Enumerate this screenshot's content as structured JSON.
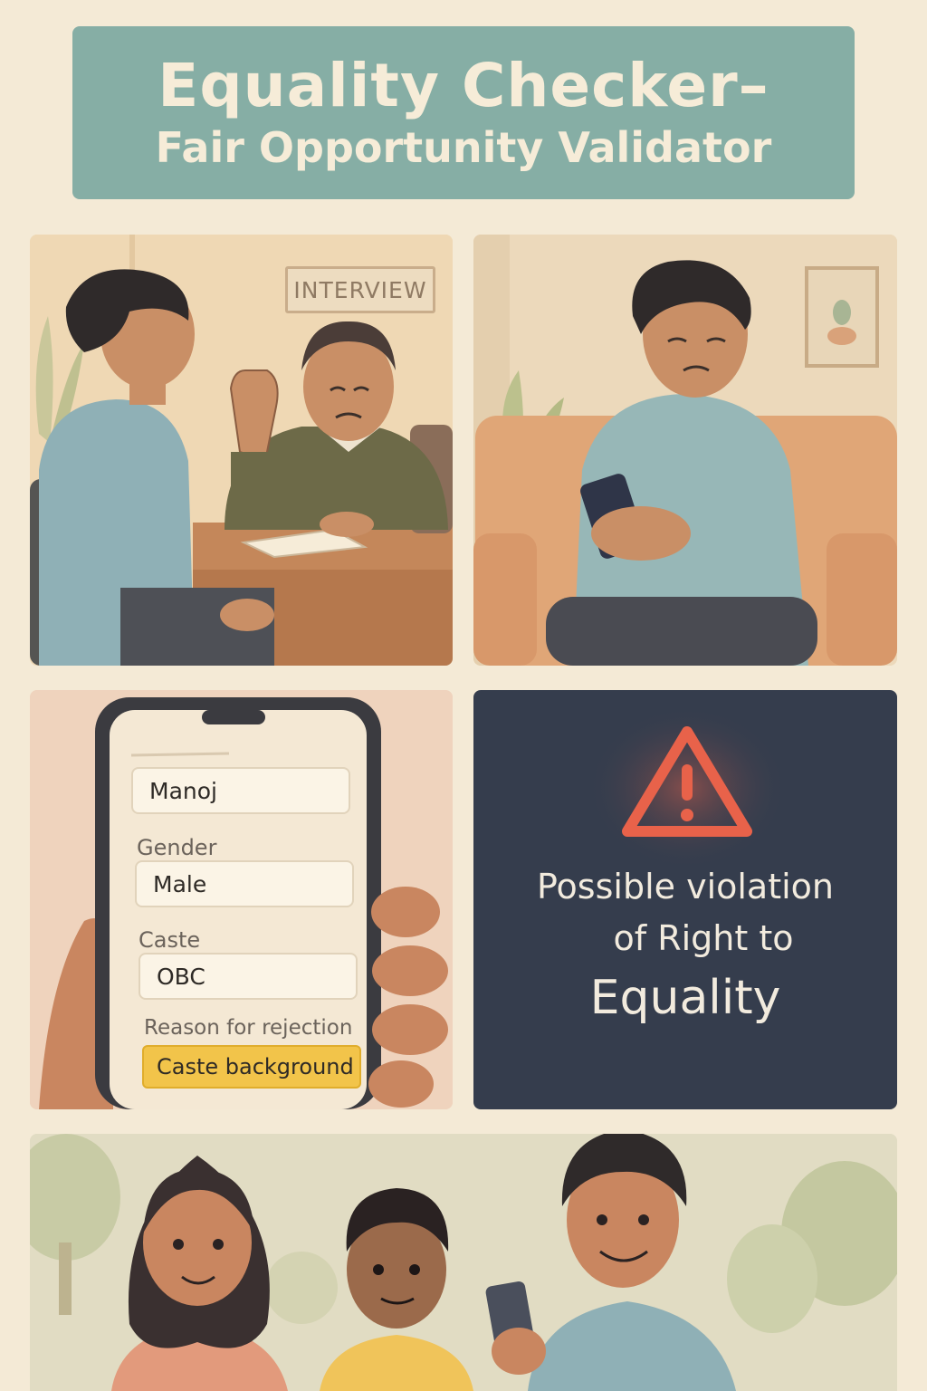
{
  "header": {
    "title": "Equality Checker–",
    "subtitle": "Fair Opportunity Validator"
  },
  "panel1": {
    "sign_text": "INTERVIEW"
  },
  "panel3": {
    "name_value": "Manoj",
    "gender_label": "Gender",
    "gender_value": "Male",
    "caste_label": "Caste",
    "caste_value": "OBC",
    "reason_label": "Reason for rejection",
    "reason_value": "Caste background"
  },
  "panel4": {
    "icon": "warning-triangle-icon",
    "line1": "Possible violation",
    "line2": "of Right to",
    "line3": "Equality",
    "accent_color": "#e8624a"
  },
  "colors": {
    "background": "#f4ead6",
    "banner": "#86aea5",
    "alert_panel": "#353d4d",
    "highlight": "#f2c44a"
  }
}
